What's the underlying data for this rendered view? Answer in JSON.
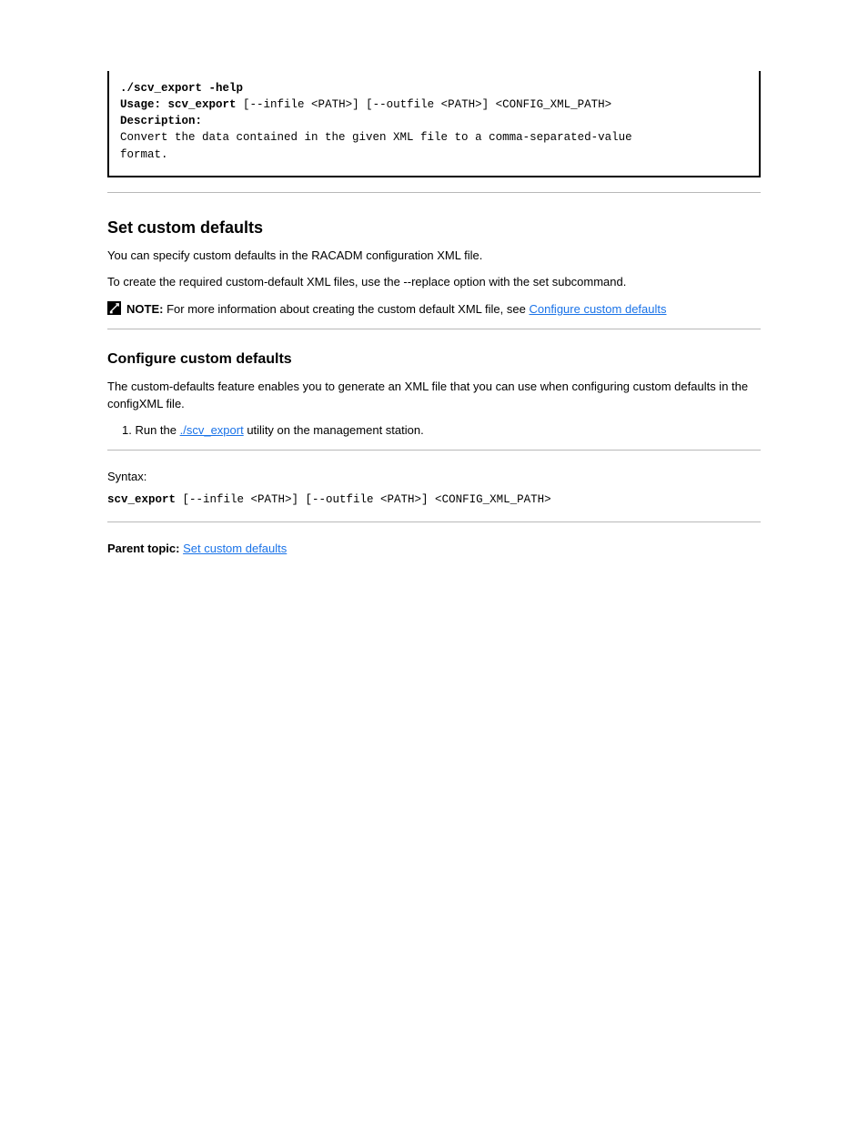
{
  "codeblock": {
    "cmd_label": "./scv_export -help",
    "usage_label": "Usage:",
    "usage_cmd": "scv_export",
    "usage_args": " [--infile <PATH>] [--outfile <PATH>] <CONFIG_XML_PATH>",
    "desc_label": "Description:",
    "desc_1": "Convert the data contained in the given XML file to a comma-separated-value",
    "desc_2": "format."
  },
  "section1": {
    "title": "Set custom defaults",
    "p1": "You can specify custom defaults in the RACADM configuration XML file.",
    "p2": "To create the required custom-default XML files, use the --replace option with the set subcommand.",
    "note_label": "NOTE:",
    "note_body": "For more information about creating the custom default XML file, see ",
    "note_link": "Configure custom defaults"
  },
  "section2": {
    "title": "Configure custom defaults",
    "p1": "The custom-defaults feature enables you to generate an XML file that you can use when configuring custom defaults in the configXML file.",
    "step_prefix": "1. Run the ",
    "step_code": "./scv_export",
    "step_suffix": " utility on the management station.",
    "syntax_label": "Syntax:",
    "syntax_cmd": "scv_export",
    "syntax_args": " [--infile <PATH>] [--outfile <PATH>] <CONFIG_XML_PATH>",
    "parent_label": "Parent topic:",
    "parent_link": "Set custom defaults"
  }
}
